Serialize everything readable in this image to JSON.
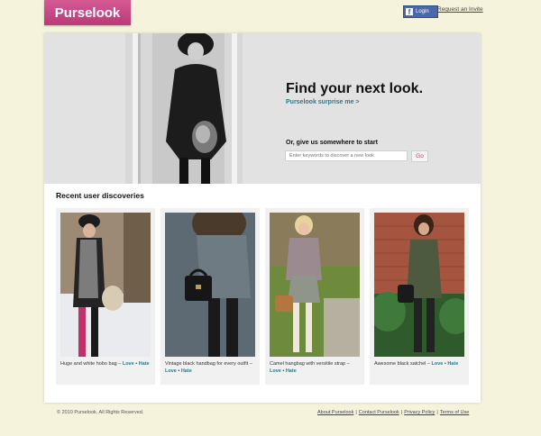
{
  "brand": {
    "logo_text": "Purselook"
  },
  "header": {
    "facebook_login_label": "Login",
    "facebook_icon_glyph": "f",
    "request_invite_label": "Request an Invite"
  },
  "hero": {
    "title": "Find your next look.",
    "surprise_link": "Purselook surprise me >",
    "search_prompt": "Or, give us somewhere to start",
    "search_placeholder": "Enter keywords to discover a new look",
    "go_label": "Go"
  },
  "discoveries": {
    "title": "Recent user discoveries",
    "items": [
      {
        "caption": "Huge and white hobo bag",
        "sep": " – ",
        "love": "Love",
        "dot": " • ",
        "hate": "Hate"
      },
      {
        "caption": "Vintage black handbag for every outfit",
        "sep": " – ",
        "love": "Love",
        "dot": " • ",
        "hate": "Hate"
      },
      {
        "caption": "Camel hangbag with versitile strap",
        "sep": " – ",
        "love": "Love",
        "dot": " • ",
        "hate": "Hate"
      },
      {
        "caption": "Awesome black satchel",
        "sep": " – ",
        "love": "Love",
        "dot": " • ",
        "hate": "Hate"
      }
    ]
  },
  "footer": {
    "copyright": "© 2010 Purselook. All Rights Reserved.",
    "links": [
      "About Purselook",
      "Contact Purselook",
      "Privacy Policy",
      "Terms of Use"
    ],
    "separator": "|"
  },
  "colors": {
    "page_bg": "#f6f3dd",
    "logo_pink": "#c84a86",
    "link_teal": "#2b7a8b",
    "facebook_blue": "#4a67a7"
  }
}
